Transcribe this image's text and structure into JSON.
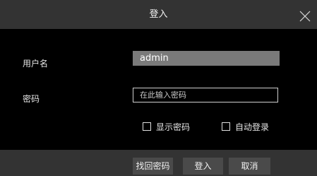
{
  "window": {
    "title": "登入"
  },
  "icons": {
    "close": "close-icon"
  },
  "form": {
    "username_label": "用户名",
    "username_value": "admin",
    "password_label": "密码",
    "password_placeholder": "在此输入密码",
    "show_password_label": "显示密码",
    "auto_login_label": "自动登录",
    "show_password_checked": false,
    "auto_login_checked": false
  },
  "buttons": {
    "recover_password": "找回密码",
    "login": "登入",
    "cancel": "取消"
  },
  "colors": {
    "titlebar": "#333333",
    "background": "#000000",
    "username_field": "#7a7a7a",
    "button": "#4a4a4a"
  }
}
